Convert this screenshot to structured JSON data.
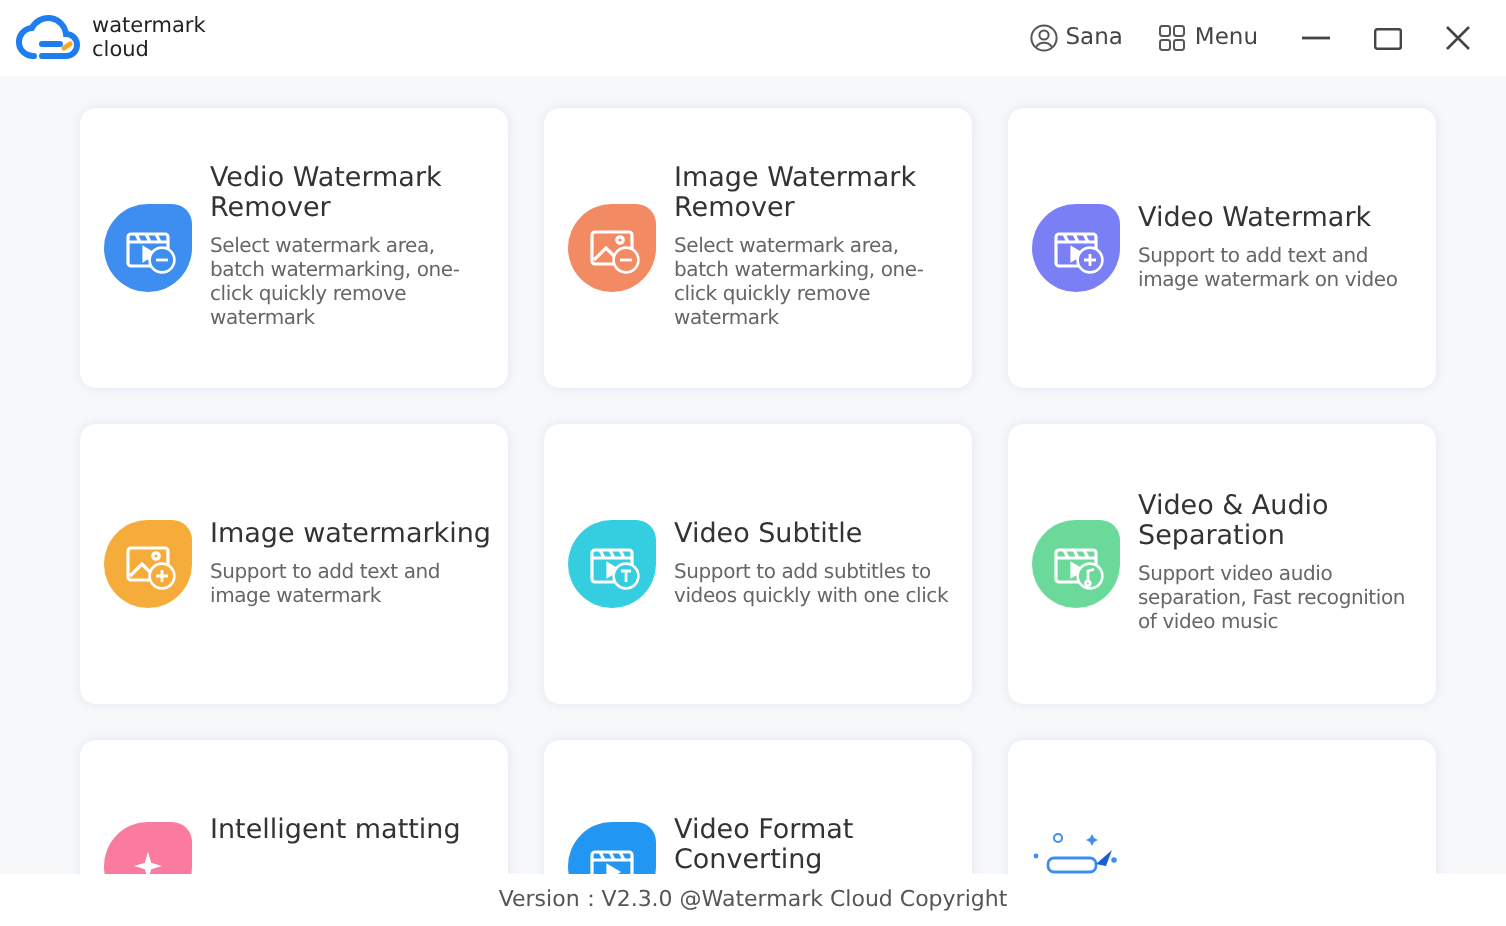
{
  "app": {
    "name_line_1": "watermark",
    "name_line_2": "cloud"
  },
  "header": {
    "user": "Sana",
    "menu": "Menu"
  },
  "cards": [
    {
      "title": "Vedio Watermark Remover",
      "description": "Select watermark area, batch watermarking, one-click quickly remove watermark",
      "kind": "videoremove",
      "color": "#3d8ef0"
    },
    {
      "title": "Image Watermark Remover",
      "description": "Select watermark area, batch watermarking, one-click quickly remove watermark",
      "kind": "imageremove",
      "color": "#f28a63"
    },
    {
      "title": "Video Watermark",
      "description": "Support to add text and image watermark on video",
      "kind": "videoadd",
      "color": "#7a7ff5"
    },
    {
      "title": "Image watermarking",
      "description": "Support to add text and image watermark",
      "kind": "imageadd",
      "color": "#f5ac3b"
    },
    {
      "title": "Video Subtitle",
      "description": "Support to add subtitles to videos quickly with one click",
      "kind": "subtitle",
      "color": "#35cde0"
    },
    {
      "title": "Video & Audio Separation",
      "description": "Support video audio separation, Fast recognition of video music",
      "kind": "separation",
      "color": "#6ad99a"
    },
    {
      "title": "Intelligent matting",
      "kind": "matting",
      "color": "#fb7aa0"
    },
    {
      "title": "Video Format Converting",
      "kind": "converting",
      "color": "#2196f3"
    },
    {
      "kind": "illustration"
    }
  ],
  "footer": {
    "version": "Version：V2.3.0 @Watermark Cloud Copyright"
  }
}
